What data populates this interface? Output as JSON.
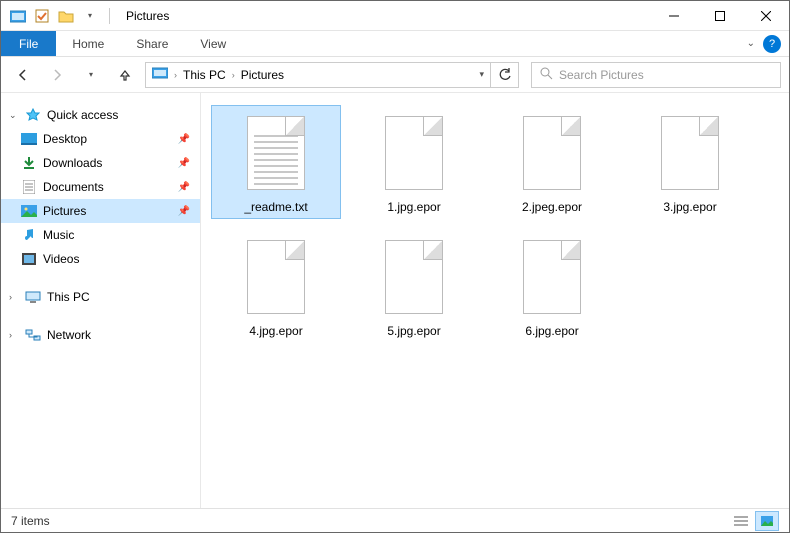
{
  "window": {
    "title": "Pictures"
  },
  "ribbon": {
    "file": "File",
    "tabs": [
      "Home",
      "Share",
      "View"
    ]
  },
  "address": {
    "crumbs": [
      "This PC",
      "Pictures"
    ]
  },
  "search": {
    "placeholder": "Search Pictures"
  },
  "nav": {
    "quick_access": {
      "label": "Quick access",
      "items": [
        {
          "label": "Desktop",
          "pinned": true,
          "icon": "desktop"
        },
        {
          "label": "Downloads",
          "pinned": true,
          "icon": "downloads"
        },
        {
          "label": "Documents",
          "pinned": true,
          "icon": "documents"
        },
        {
          "label": "Pictures",
          "pinned": true,
          "icon": "pictures",
          "selected": true
        },
        {
          "label": "Music",
          "pinned": false,
          "icon": "music"
        },
        {
          "label": "Videos",
          "pinned": false,
          "icon": "videos"
        }
      ]
    },
    "this_pc": {
      "label": "This PC"
    },
    "network": {
      "label": "Network"
    }
  },
  "files": [
    {
      "name": "_readme.txt",
      "type": "text",
      "selected": true
    },
    {
      "name": "1.jpg.epor",
      "type": "blank"
    },
    {
      "name": "2.jpeg.epor",
      "type": "blank"
    },
    {
      "name": "3.jpg.epor",
      "type": "blank"
    },
    {
      "name": "4.jpg.epor",
      "type": "blank"
    },
    {
      "name": "5.jpg.epor",
      "type": "blank"
    },
    {
      "name": "6.jpg.epor",
      "type": "blank"
    }
  ],
  "status": {
    "count_label": "7 items"
  }
}
